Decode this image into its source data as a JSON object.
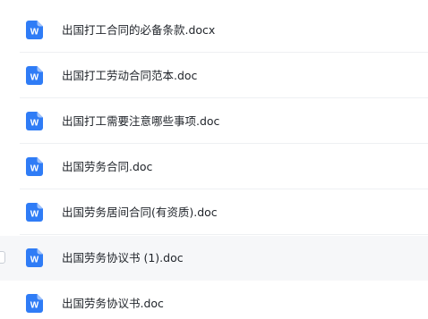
{
  "file_list": {
    "items": [
      {
        "name": "出国打工合同的必备条款.docx",
        "icon": "word-document-icon",
        "selected": false
      },
      {
        "name": "出国打工劳动合同范本.doc",
        "icon": "word-document-icon",
        "selected": false
      },
      {
        "name": "出国打工需要注意哪些事项.doc",
        "icon": "word-document-icon",
        "selected": false
      },
      {
        "name": "出国劳务合同.doc",
        "icon": "word-document-icon",
        "selected": false
      },
      {
        "name": "出国劳务居间合同(有资质).doc",
        "icon": "word-document-icon",
        "selected": false
      },
      {
        "name": "出国劳务协议书 (1).doc",
        "icon": "word-document-icon",
        "selected": true
      },
      {
        "name": "出国劳务协议书.doc",
        "icon": "word-document-icon",
        "selected": false
      }
    ]
  },
  "colors": {
    "icon_blue": "#2f7cf6",
    "selected_row_bg": "#f6f7f9",
    "text": "#1f2329"
  }
}
